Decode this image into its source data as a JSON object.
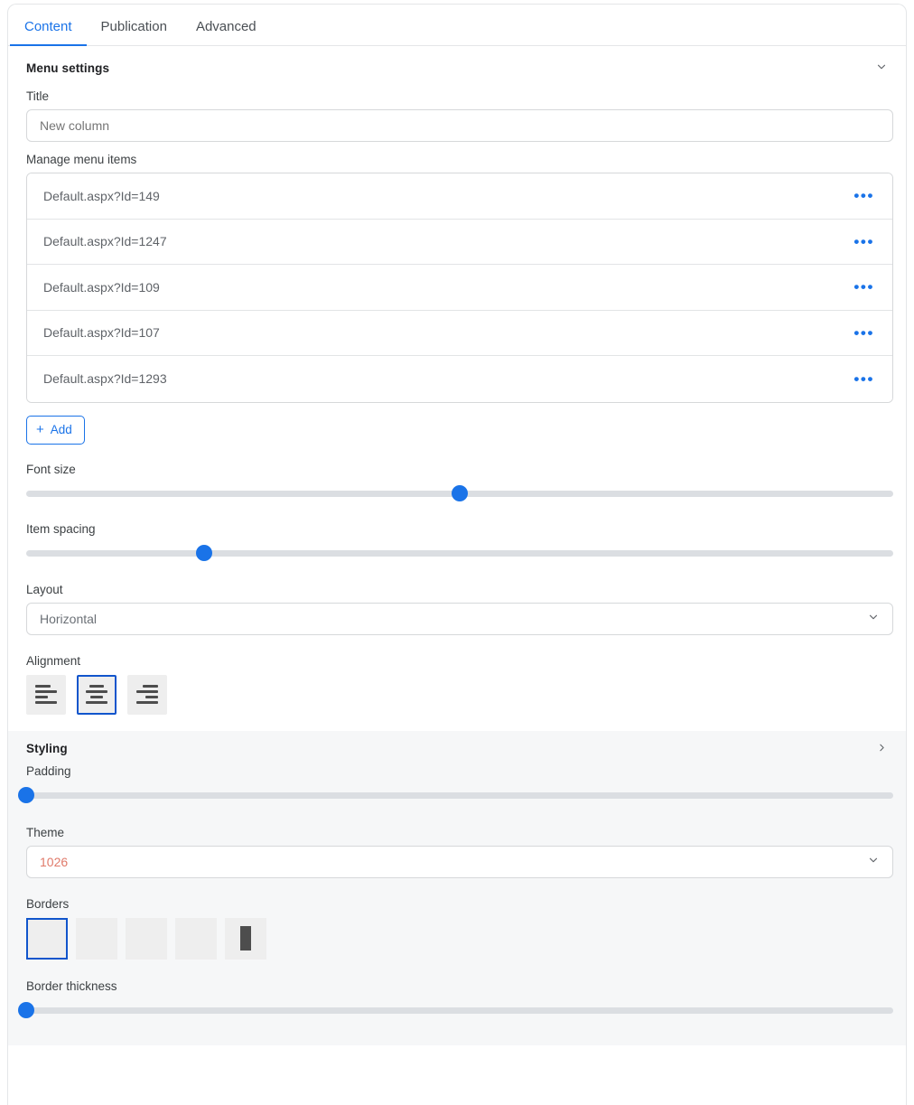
{
  "tabs": [
    {
      "label": "Content",
      "active": true
    },
    {
      "label": "Publication",
      "active": false
    },
    {
      "label": "Advanced",
      "active": false
    }
  ],
  "menu_settings": {
    "heading": "Menu settings",
    "collapse_icon": "chevron-down-icon",
    "title_label": "Title",
    "title_value": "New column",
    "title_placeholder": "New column",
    "manage_label": "Manage menu items",
    "items": [
      {
        "label": "Default.aspx?Id=149",
        "menu_icon": "ellipsis-icon"
      },
      {
        "label": "Default.aspx?Id=1247",
        "menu_icon": "ellipsis-icon"
      },
      {
        "label": "Default.aspx?Id=109",
        "menu_icon": "ellipsis-icon"
      },
      {
        "label": "Default.aspx?Id=107",
        "menu_icon": "ellipsis-icon"
      },
      {
        "label": "Default.aspx?Id=1293",
        "menu_icon": "ellipsis-icon"
      }
    ],
    "add_button": {
      "icon": "plus-icon",
      "label": "Add"
    },
    "font_size": {
      "label": "Font size",
      "value_pct": 50
    },
    "item_spacing": {
      "label": "Item spacing",
      "value_pct": 20.5
    },
    "layout": {
      "label": "Layout",
      "value": "Horizontal",
      "arrow_icon": "chevron-down-icon"
    },
    "alignment": {
      "label": "Alignment",
      "options": [
        {
          "name": "align-left",
          "selected": false
        },
        {
          "name": "align-center",
          "selected": true
        },
        {
          "name": "align-right",
          "selected": false
        }
      ]
    }
  },
  "styling": {
    "heading": "Styling",
    "expand_icon": "chevron-right-icon",
    "padding": {
      "label": "Padding",
      "value_pct": 0
    },
    "theme": {
      "label": "Theme",
      "value": "1026",
      "arrow_icon": "chevron-down-icon"
    },
    "borders": {
      "label": "Borders",
      "options": [
        {
          "name": "border-none",
          "selected": true
        },
        {
          "name": "border-top",
          "selected": false
        },
        {
          "name": "border-bottom",
          "selected": false
        },
        {
          "name": "border-top-bottom",
          "selected": false
        },
        {
          "name": "border-all",
          "selected": false
        }
      ]
    },
    "border_thickness": {
      "label": "Border thickness",
      "value_pct": 0
    }
  },
  "colors": {
    "accent": "#1a73e8",
    "selected_outline": "#1155cc",
    "theme_value": "#e07a6a",
    "track": "#dbdee2",
    "swatch_bg": "#eeeeee",
    "panel_bg": "#f6f7f8"
  }
}
